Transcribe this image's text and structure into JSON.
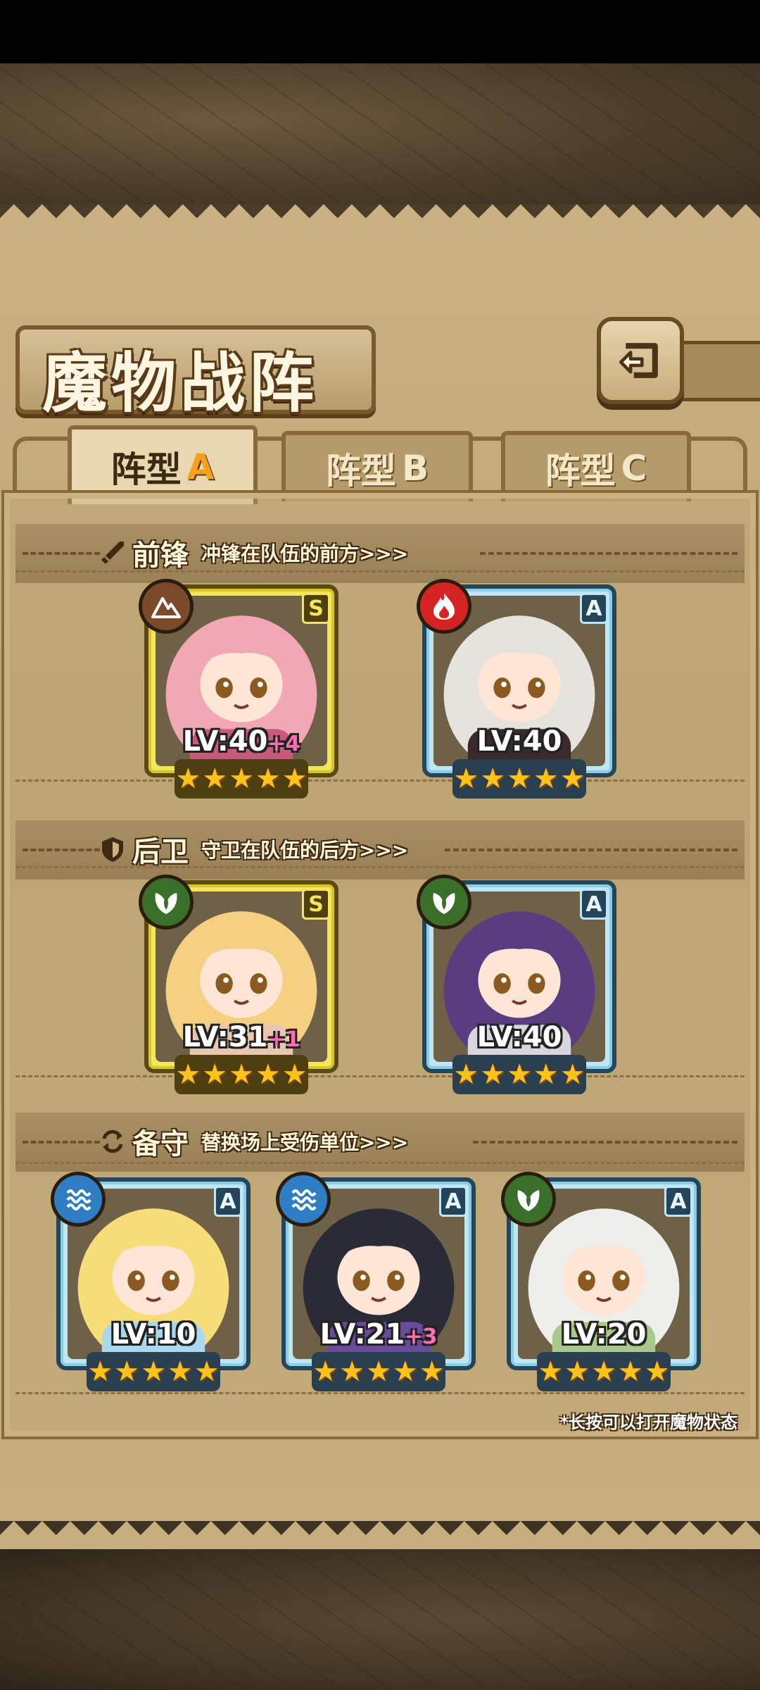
{
  "page": {
    "title": "魔物战阵",
    "hint": "*长按可以打开魔物状态"
  },
  "tabs": [
    {
      "label": "阵型",
      "letter": "A",
      "active": true
    },
    {
      "label": "阵型",
      "letter": "B",
      "active": false
    },
    {
      "label": "阵型",
      "letter": "C",
      "active": false
    }
  ],
  "sections": {
    "vanguard": {
      "name": "前锋",
      "desc": "冲锋在队伍的前方>>>",
      "icon": "sword-icon"
    },
    "rearguard": {
      "name": "后卫",
      "desc": "守卫在队伍的后方>>>",
      "icon": "shield-icon"
    },
    "reserve": {
      "name": "备守",
      "desc": "替换场上受伤单位>>>",
      "icon": "swap-icon"
    }
  },
  "units": {
    "vanguard": [
      {
        "rank": "S",
        "element": "earth",
        "level": "LV:40",
        "bonus": "+4",
        "stars": "★★★★★",
        "palette": [
          "#f2a8b4",
          "#c75a7a"
        ]
      },
      {
        "rank": "A",
        "element": "fire",
        "level": "LV:40",
        "bonus": "",
        "stars": "★★★★★",
        "palette": [
          "#e6e3de",
          "#3a2a2a"
        ]
      }
    ],
    "rearguard": [
      {
        "rank": "S",
        "element": "nature",
        "level": "LV:31",
        "bonus": "+1",
        "stars": "★★★★★",
        "palette": [
          "#f5d080",
          "#e9c6b0"
        ]
      },
      {
        "rank": "A",
        "element": "nature",
        "level": "LV:40",
        "bonus": "",
        "stars": "★★★★★",
        "palette": [
          "#5a3d80",
          "#d8d4e0"
        ]
      }
    ],
    "reserve": [
      {
        "rank": "A",
        "element": "water",
        "level": "LV:10",
        "bonus": "",
        "stars": "★★★★★",
        "palette": [
          "#f6dd7a",
          "#a9d8ee"
        ]
      },
      {
        "rank": "A",
        "element": "water",
        "level": "LV:21",
        "bonus": "+3",
        "stars": "★★★★★",
        "palette": [
          "#2b2b38",
          "#6a4a9a"
        ]
      },
      {
        "rank": "A",
        "element": "nature",
        "level": "LV:20",
        "bonus": "",
        "stars": "★★★★★",
        "palette": [
          "#eeeeea",
          "#a9c98a"
        ]
      }
    ]
  },
  "colors": {
    "accent": "#f5a21a",
    "bonus": "#ff6fb0",
    "star": "#ffc21a"
  }
}
